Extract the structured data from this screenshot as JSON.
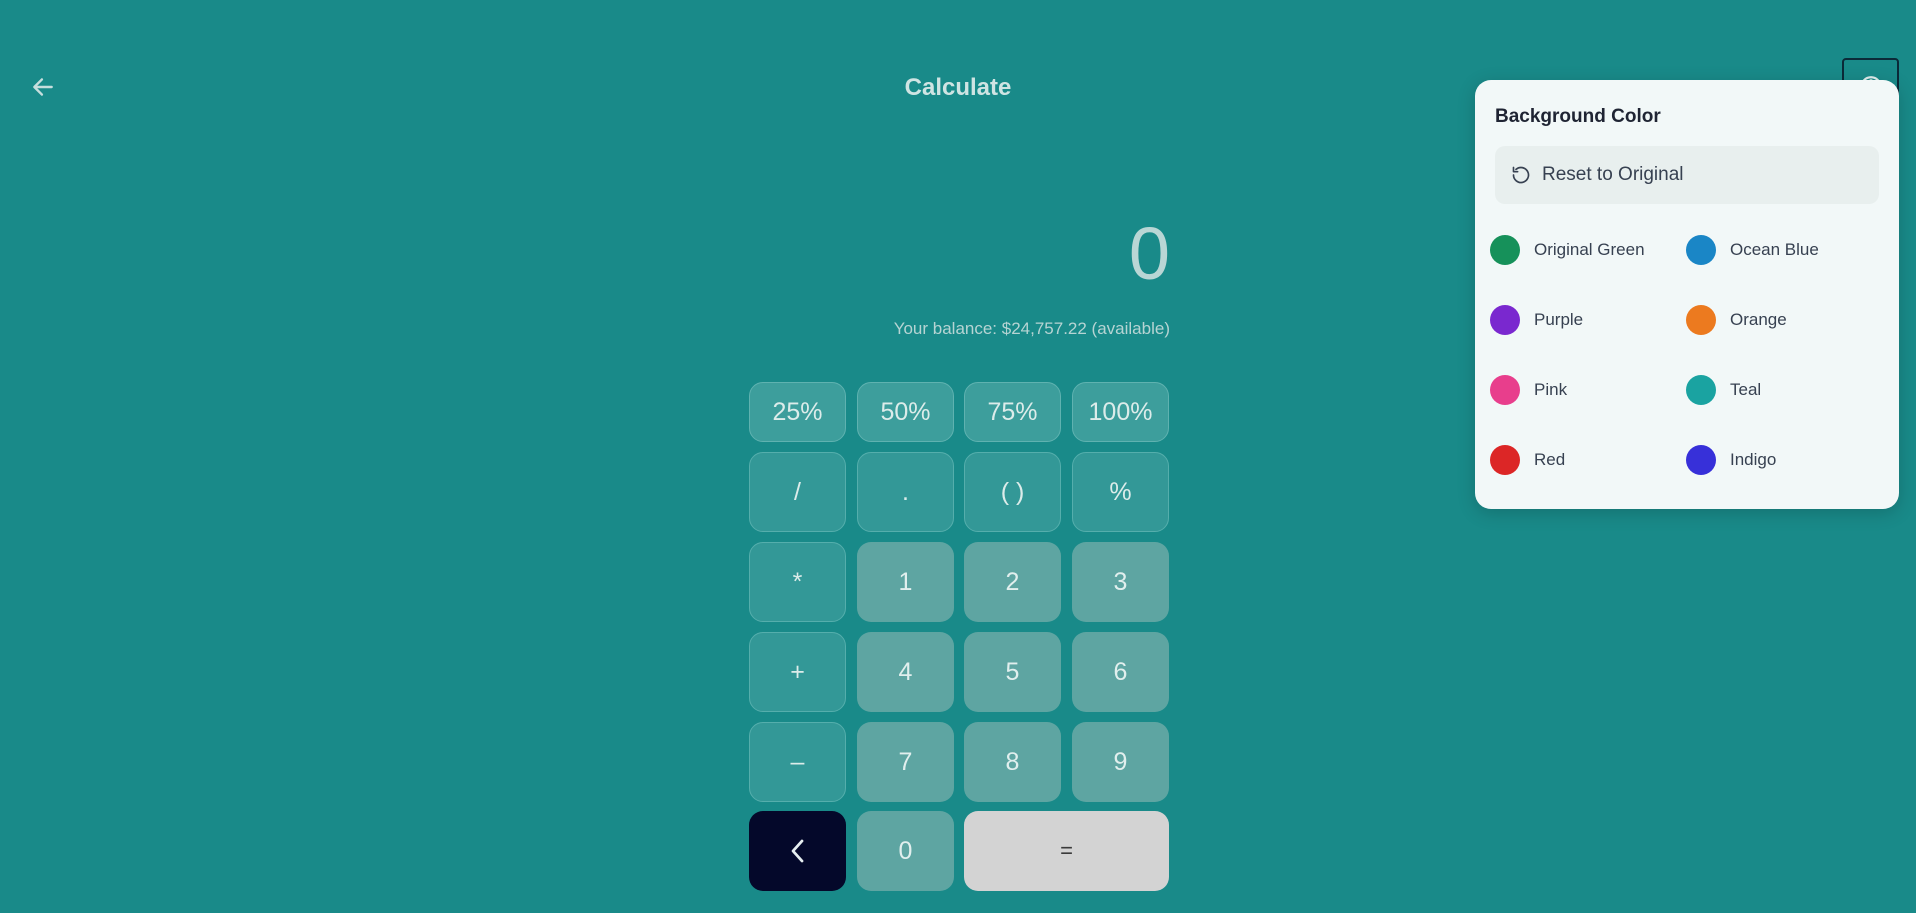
{
  "header": {
    "title": "Calculate",
    "back_icon": "arrow-left-icon",
    "settings_icon": "palette-icon"
  },
  "calculator": {
    "display_value": "0",
    "balance_text": "Your balance: $24,757.22 (available)",
    "percent_keys": [
      "25%",
      "50%",
      "75%",
      "100%"
    ],
    "row1": [
      "/",
      ".",
      "( )",
      "%"
    ],
    "row2": [
      "*",
      "1",
      "2",
      "3"
    ],
    "row3": [
      "+",
      "4",
      "5",
      "6"
    ],
    "row4": [
      "–",
      "7",
      "8",
      "9"
    ],
    "backspace_icon": "chevron-left-icon",
    "zero": "0",
    "equals": "="
  },
  "color_menu": {
    "title": "Background Color",
    "reset_label": "Reset to Original",
    "reset_icon": "rotate-ccw-icon",
    "options": [
      {
        "label": "Original Green",
        "color": "#16915a"
      },
      {
        "label": "Ocean Blue",
        "color": "#1a86c6"
      },
      {
        "label": "Purple",
        "color": "#7a28cf"
      },
      {
        "label": "Orange",
        "color": "#ec7a1f"
      },
      {
        "label": "Pink",
        "color": "#e83e8c"
      },
      {
        "label": "Teal",
        "color": "#1aa3a1"
      },
      {
        "label": "Red",
        "color": "#dc2626"
      },
      {
        "label": "Indigo",
        "color": "#3730d9"
      }
    ]
  },
  "theme": {
    "background": "#198a89",
    "accent_dark": "#04082a"
  }
}
